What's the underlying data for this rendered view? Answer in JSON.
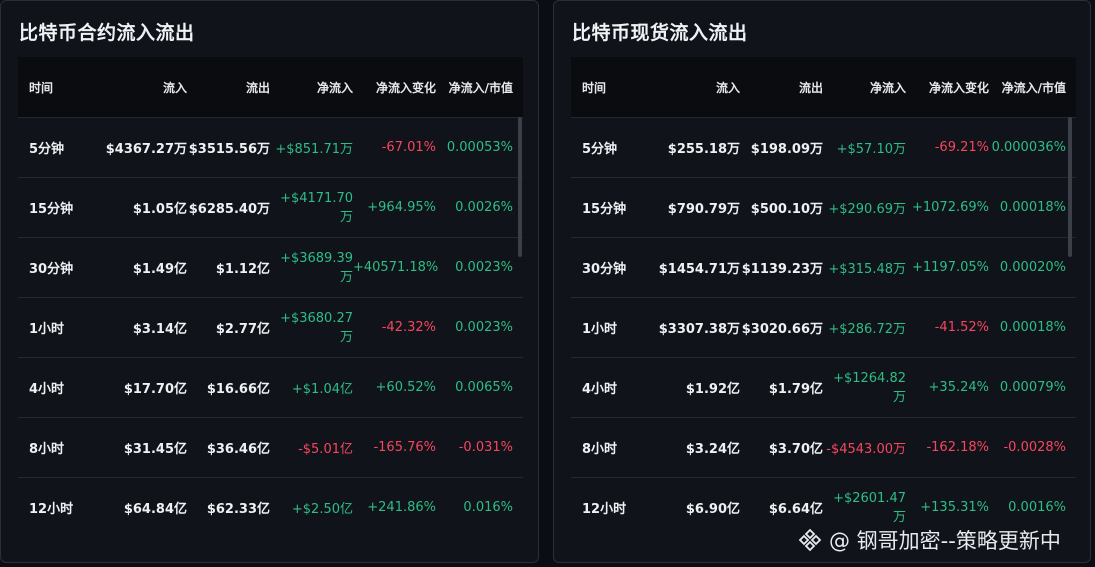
{
  "left_panel": {
    "title": "比特币合约流入流出",
    "headers": [
      "时间",
      "流入",
      "流出",
      "净流入",
      "净流入变化",
      "净流入/市值"
    ],
    "rows": [
      {
        "time": "5分钟",
        "inflow": "$4367.27万",
        "outflow": "$3515.56万",
        "net": "+$851.71万",
        "net_sign": "pos",
        "change": "-67.01%",
        "change_sign": "neg",
        "ratio": "0.00053%",
        "ratio_sign": "pos"
      },
      {
        "time": "15分钟",
        "inflow": "$1.05亿",
        "outflow": "$6285.40万",
        "net": "+$4171.70万",
        "net_sign": "pos",
        "change": "+964.95%",
        "change_sign": "pos",
        "ratio": "0.0026%",
        "ratio_sign": "pos"
      },
      {
        "time": "30分钟",
        "inflow": "$1.49亿",
        "outflow": "$1.12亿",
        "net": "+$3689.39万",
        "net_sign": "pos",
        "change": "+40571.18%",
        "change_sign": "pos",
        "ratio": "0.0023%",
        "ratio_sign": "pos"
      },
      {
        "time": "1小时",
        "inflow": "$3.14亿",
        "outflow": "$2.77亿",
        "net": "+$3680.27万",
        "net_sign": "pos",
        "change": "-42.32%",
        "change_sign": "neg",
        "ratio": "0.0023%",
        "ratio_sign": "pos"
      },
      {
        "time": "4小时",
        "inflow": "$17.70亿",
        "outflow": "$16.66亿",
        "net": "+$1.04亿",
        "net_sign": "pos",
        "change": "+60.52%",
        "change_sign": "pos",
        "ratio": "0.0065%",
        "ratio_sign": "pos"
      },
      {
        "time": "8小时",
        "inflow": "$31.45亿",
        "outflow": "$36.46亿",
        "net": "-$5.01亿",
        "net_sign": "neg",
        "change": "-165.76%",
        "change_sign": "neg",
        "ratio": "-0.031%",
        "ratio_sign": "neg"
      },
      {
        "time": "12小时",
        "inflow": "$64.84亿",
        "outflow": "$62.33亿",
        "net": "+$2.50亿",
        "net_sign": "pos",
        "change": "+241.86%",
        "change_sign": "pos",
        "ratio": "0.016%",
        "ratio_sign": "pos"
      }
    ]
  },
  "right_panel": {
    "title": "比特币现货流入流出",
    "headers": [
      "时间",
      "流入",
      "流出",
      "净流入",
      "净流入变化",
      "净流入/市值"
    ],
    "rows": [
      {
        "time": "5分钟",
        "inflow": "$255.18万",
        "outflow": "$198.09万",
        "net": "+$57.10万",
        "net_sign": "pos",
        "change": "-69.21%",
        "change_sign": "neg",
        "ratio": "0.000036%",
        "ratio_sign": "pos"
      },
      {
        "time": "15分钟",
        "inflow": "$790.79万",
        "outflow": "$500.10万",
        "net": "+$290.69万",
        "net_sign": "pos",
        "change": "+1072.69%",
        "change_sign": "pos",
        "ratio": "0.00018%",
        "ratio_sign": "pos"
      },
      {
        "time": "30分钟",
        "inflow": "$1454.71万",
        "outflow": "$1139.23万",
        "net": "+$315.48万",
        "net_sign": "pos",
        "change": "+1197.05%",
        "change_sign": "pos",
        "ratio": "0.00020%",
        "ratio_sign": "pos"
      },
      {
        "time": "1小时",
        "inflow": "$3307.38万",
        "outflow": "$3020.66万",
        "net": "+$286.72万",
        "net_sign": "pos",
        "change": "-41.52%",
        "change_sign": "neg",
        "ratio": "0.00018%",
        "ratio_sign": "pos"
      },
      {
        "time": "4小时",
        "inflow": "$1.92亿",
        "outflow": "$1.79亿",
        "net": "+$1264.82万",
        "net_sign": "pos",
        "change": "+35.24%",
        "change_sign": "pos",
        "ratio": "0.00079%",
        "ratio_sign": "pos"
      },
      {
        "time": "8小时",
        "inflow": "$3.24亿",
        "outflow": "$3.70亿",
        "net": "-$4543.00万",
        "net_sign": "neg",
        "change": "-162.18%",
        "change_sign": "neg",
        "ratio": "-0.0028%",
        "ratio_sign": "neg"
      },
      {
        "time": "12小时",
        "inflow": "$6.90亿",
        "outflow": "$6.64亿",
        "net": "+$2601.47万",
        "net_sign": "pos",
        "change": "+135.31%",
        "change_sign": "pos",
        "ratio": "0.0016%",
        "ratio_sign": "pos"
      }
    ]
  },
  "watermark": {
    "text": "@ 钢哥加密--策略更新中",
    "icon": "binance-logo-icon"
  },
  "colors": {
    "positive": "#2ebd85",
    "negative": "#f6465d",
    "background": "#0b0d12",
    "panel": "#10131a"
  }
}
